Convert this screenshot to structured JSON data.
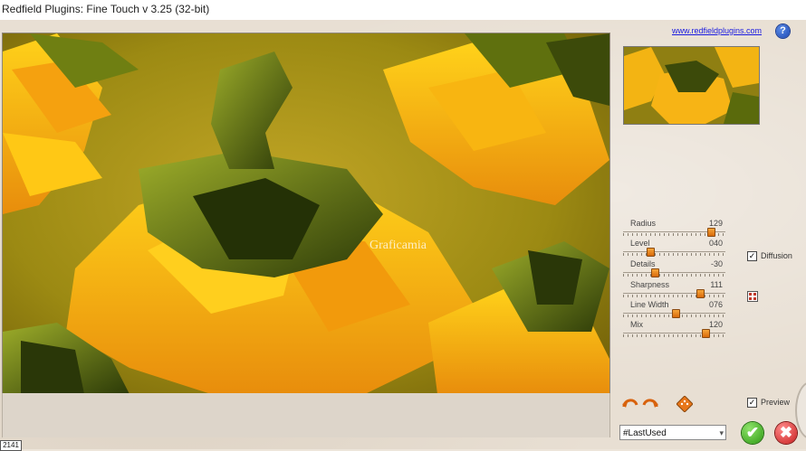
{
  "window": {
    "title": "Redfield Plugins: Fine Touch v 3.25 (32-bit)"
  },
  "header": {
    "link_text": "www.redfieldplugins.com",
    "help_label": "?"
  },
  "preview": {
    "watermark": "Graficamia"
  },
  "sliders": [
    {
      "label": "Radius",
      "value": "129",
      "position": 0.85
    },
    {
      "label": "Level",
      "value": "040",
      "position": 0.26
    },
    {
      "label": "Details",
      "value": "-30",
      "position": 0.3
    },
    {
      "label": "Sharpness",
      "value": "111",
      "position": 0.74
    },
    {
      "label": "Line Width",
      "value": "076",
      "position": 0.5
    },
    {
      "label": "Mix",
      "value": "120",
      "position": 0.8
    }
  ],
  "options": {
    "diffusion": {
      "label": "Diffusion",
      "checked": true
    },
    "preview": {
      "label": "Preview",
      "checked": true
    }
  },
  "preset": {
    "selected": "#LastUsed"
  },
  "status": {
    "value": "2141"
  },
  "colors": {
    "accent": "#e8761a",
    "ok": "#2d9a12",
    "cancel": "#c81d1d",
    "link": "#1a1ae0"
  }
}
